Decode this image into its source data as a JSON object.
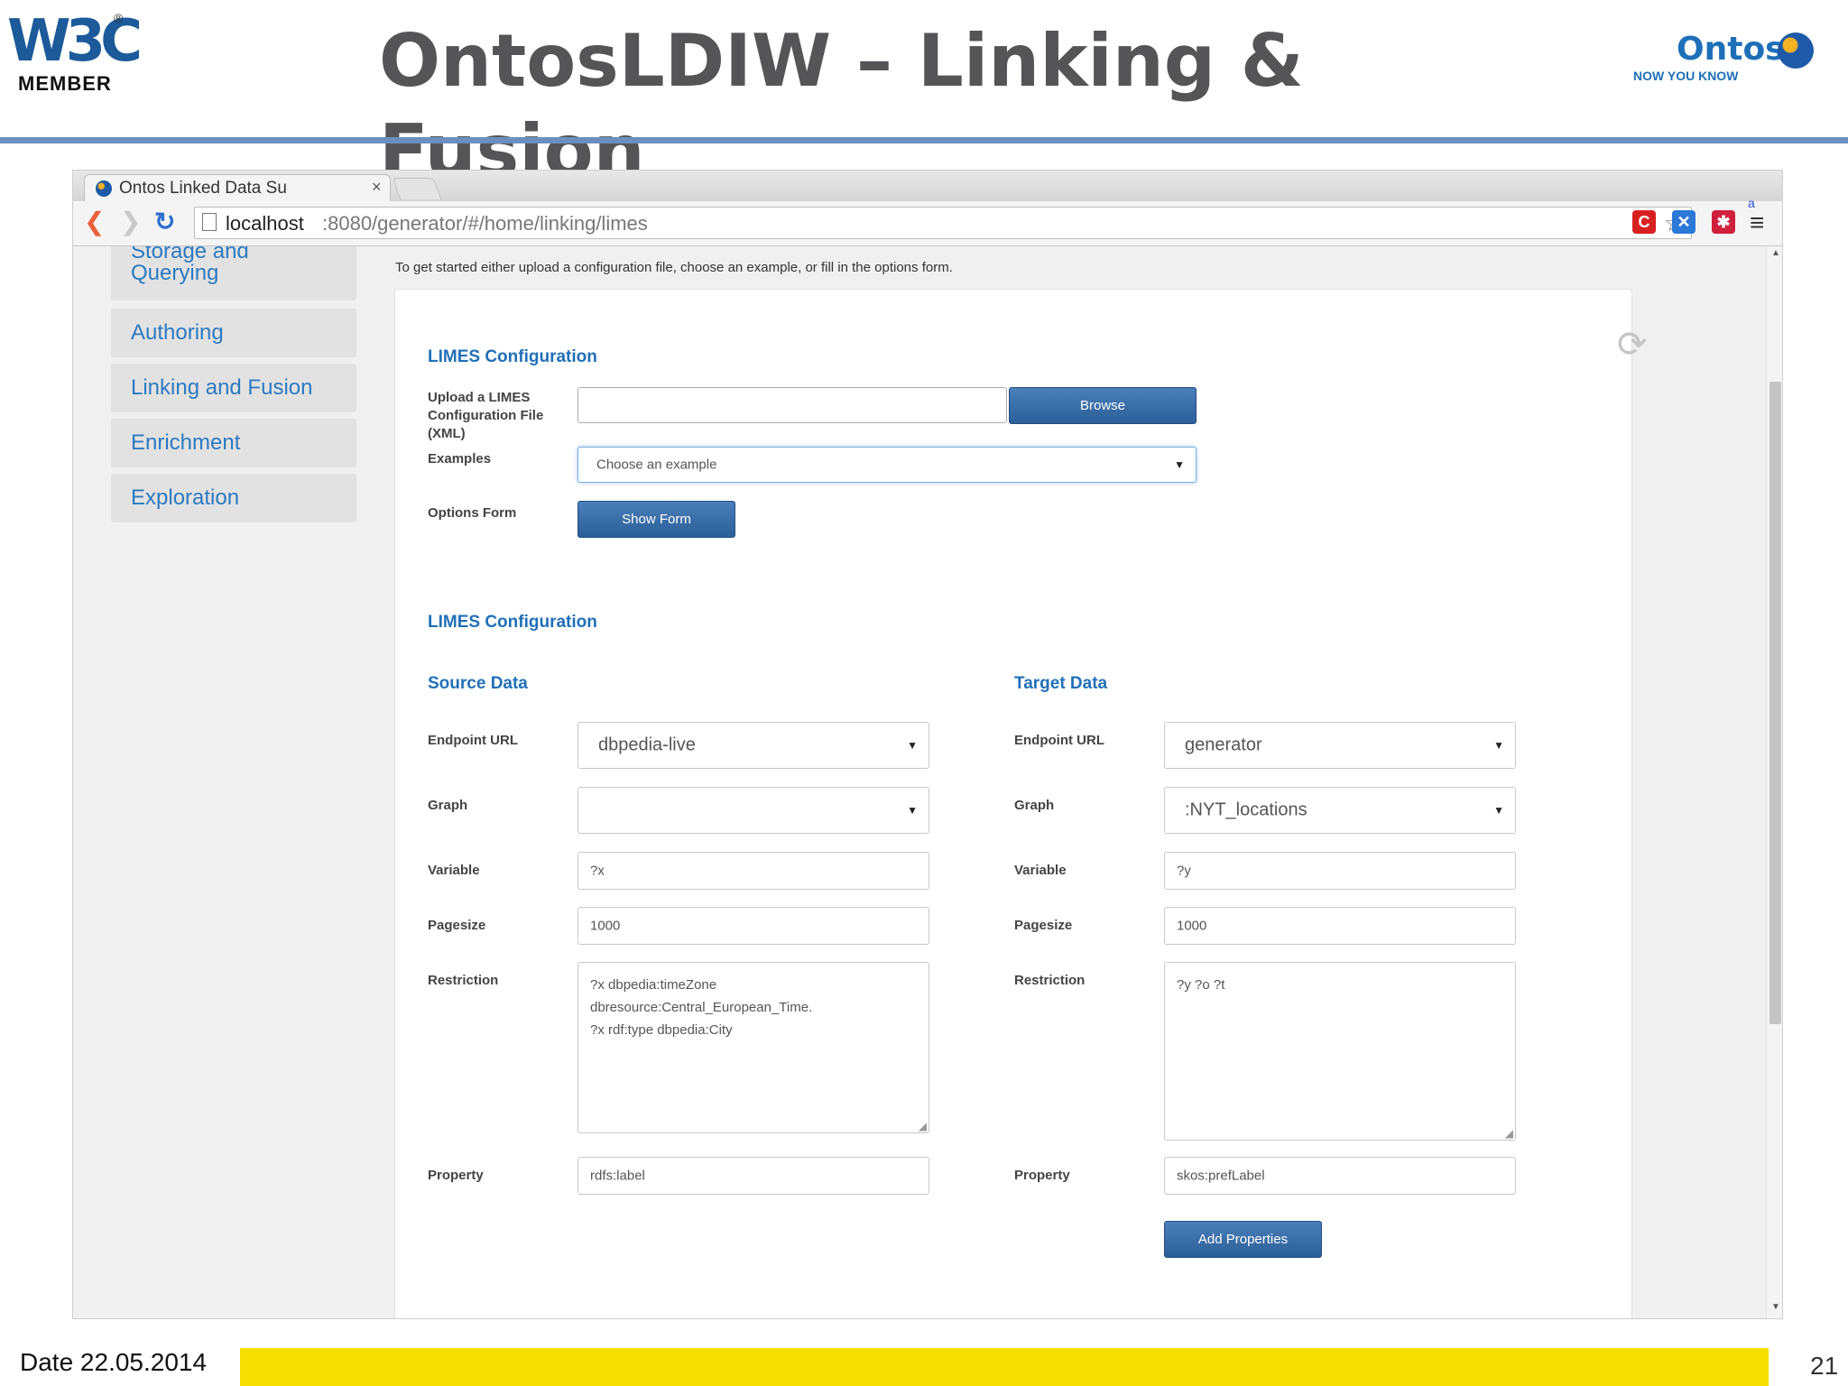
{
  "slide": {
    "title": "OntosLDIW – Linking & Fusion",
    "w3c_logo": {
      "mark": "W3C",
      "reg": "®",
      "member": "MEMBER"
    },
    "ontos_logo": {
      "name": "Ontos",
      "tagline": "NOW YOU KNOW"
    },
    "footer": {
      "date": "Date 22.05.2014",
      "page_number": "21"
    },
    "colors": {
      "title_rule": "#6b8fbf",
      "footer_bar": "#f6de00",
      "title_text": "#555558"
    }
  },
  "browser": {
    "tab_title": "Ontos Linked Data Su",
    "tab_close": "×",
    "url_host": "localhost",
    "url_rest": ":8080/generator/#/home/linking/limes",
    "icons": [
      "back-icon",
      "forward-icon",
      "reload-icon",
      "page-icon",
      "extension-icon",
      "bookmark-star-icon",
      "menu-icon"
    ],
    "extensions": {
      "c": "C",
      "x": "✕",
      "asterisk": "✱",
      "a": "a"
    }
  },
  "sidebar": {
    "items": [
      {
        "label": "Storage and Querying",
        "line1": "Storage and",
        "line2": "Querying"
      },
      {
        "label": "Authoring"
      },
      {
        "label": "Linking and Fusion"
      },
      {
        "label": "Enrichment"
      },
      {
        "label": "Exploration"
      }
    ],
    "color": "#2d79c1"
  },
  "main": {
    "intro": "To get started either upload a configuration file, choose an example, or fill in the options form.",
    "config_heading": "LIMES Configuration",
    "upload_label_line1": "Upload a LIMES",
    "upload_label_line2": "Configuration File",
    "upload_label_line3": "(XML)",
    "upload_value": "",
    "browse_button": "Browse",
    "examples_label": "Examples",
    "examples_select": "Choose an example",
    "options_label": "Options Form",
    "show_form_button": "Show Form",
    "config_heading_2": "LIMES Configuration",
    "source": {
      "heading": "Source Data",
      "endpoint_label": "Endpoint URL",
      "endpoint_value": "dbpedia-live",
      "graph_label": "Graph",
      "graph_value": "",
      "variable_label": "Variable",
      "variable_value": "?x",
      "pagesize_label": "Pagesize",
      "pagesize_value": "1000",
      "restriction_label": "Restriction",
      "restriction_value": "?x dbpedia:timeZone\ndbresource:Central_European_Time.\n?x rdf:type dbpedia:City",
      "property_label": "Property",
      "property_value": "rdfs:label"
    },
    "target": {
      "heading": "Target Data",
      "endpoint_label": "Endpoint URL",
      "endpoint_value": "generator",
      "graph_label": "Graph",
      "graph_value": ":NYT_locations",
      "variable_label": "Variable",
      "variable_value": "?y",
      "pagesize_label": "Pagesize",
      "pagesize_value": "1000",
      "restriction_label": "Restriction",
      "restriction_value": "?y ?o ?t",
      "property_label": "Property",
      "property_value": "skos:prefLabel",
      "add_properties_button": "Add Properties"
    },
    "colors": {
      "heading": "#2170b8",
      "button": "#2b5f98"
    }
  }
}
